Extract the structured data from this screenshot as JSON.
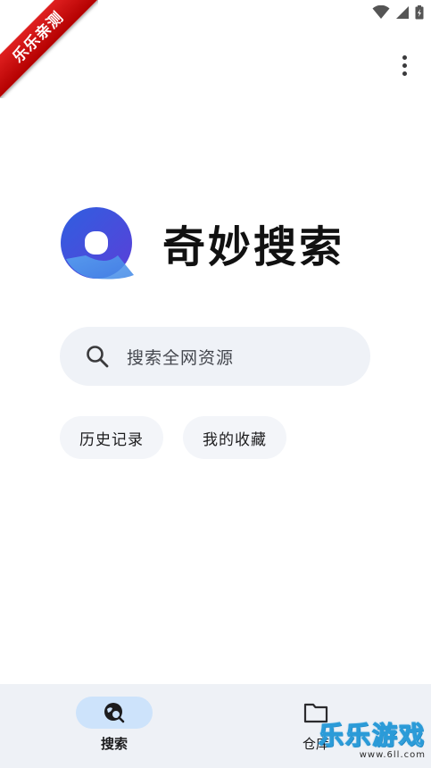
{
  "ribbon": {
    "text": "乐乐亲测"
  },
  "app": {
    "title": "奇妙搜索"
  },
  "search": {
    "placeholder": "搜索全网资源"
  },
  "chips": [
    {
      "label": "历史记录"
    },
    {
      "label": "我的收藏"
    }
  ],
  "bottom_nav": {
    "items": [
      {
        "label": "搜索",
        "icon": "search-globe-icon",
        "active": true
      },
      {
        "label": "仓库",
        "icon": "folder-icon",
        "active": false
      }
    ]
  },
  "watermark": {
    "main": "乐乐游戏",
    "sub": "www.6ll.com"
  },
  "colors": {
    "accent_pill": "#cde3fb",
    "search_bg": "#eff2f7",
    "nav_bg": "#eef1f6",
    "ribbon": "#d01010",
    "logo_blue": "#3b6fe6"
  }
}
